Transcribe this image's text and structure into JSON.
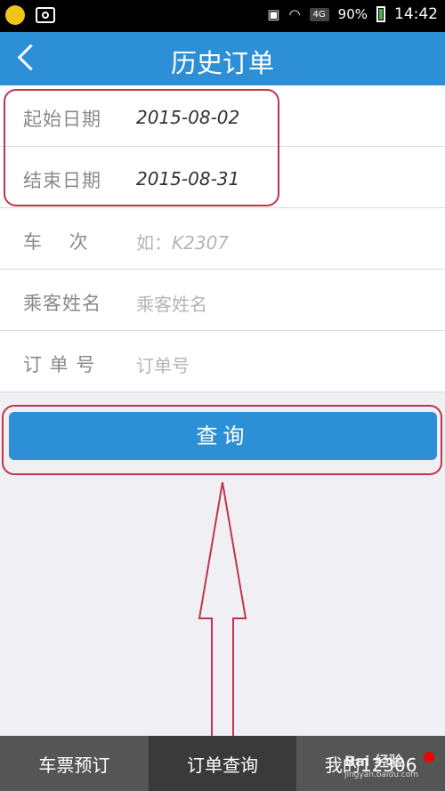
{
  "status_bar": {
    "network": "4G",
    "battery": "90%",
    "time": "14:42"
  },
  "nav": {
    "title": "历史订单"
  },
  "form": {
    "start_date": {
      "label": "起始日期",
      "value": "2015-08-02"
    },
    "end_date": {
      "label": "结束日期",
      "value": "2015-08-31"
    },
    "train_no": {
      "label": "车　 次",
      "placeholder_prefix": "如：",
      "placeholder_example": "K2307"
    },
    "passenger": {
      "label": "乘客姓名",
      "placeholder": "乘客姓名"
    },
    "order_no": {
      "label": "订 单 号",
      "placeholder": "订单号"
    }
  },
  "query_button": "查询",
  "tabs": [
    {
      "label": "车票预订",
      "active": false
    },
    {
      "label": "订单查询",
      "active": true
    },
    {
      "label": "我的12306",
      "active": false
    }
  ],
  "watermark": {
    "text": "Bai 经验",
    "sub": "jingyan.baidu.com"
  },
  "colors": {
    "primary": "#2d8fd5",
    "annotation": "#c0354b"
  }
}
